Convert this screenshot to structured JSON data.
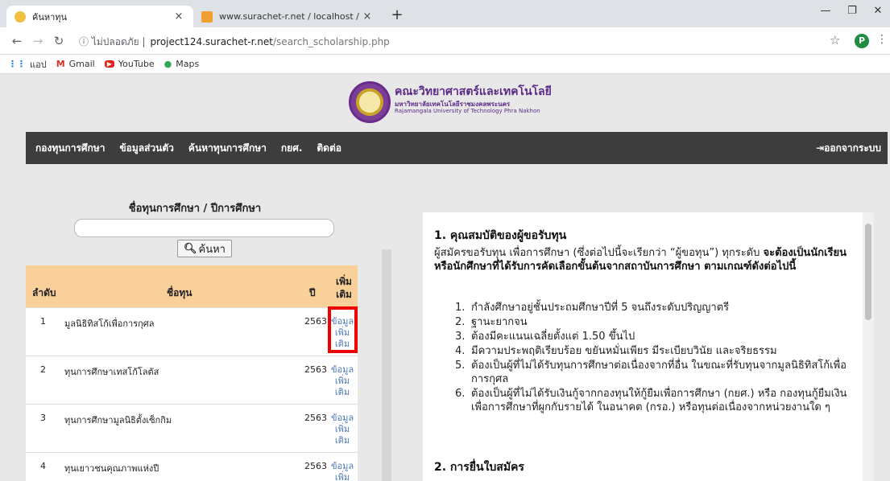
{
  "browser": {
    "tabs": [
      {
        "title": "ค้นหาทุน",
        "close": "×"
      },
      {
        "title": "www.surachet-r.net / localhost /",
        "close": "×"
      }
    ],
    "newtab": "+",
    "window": {
      "minimize": "—",
      "maximize": "❐",
      "close": "✕"
    },
    "address": {
      "security": "ⓘ ไม่ปลอดภัย |",
      "host": "project124.surachet-r.net",
      "path": "/search_scholarship.php"
    },
    "avatar_letter": "P",
    "bookmarks": [
      {
        "label": "แอป",
        "icon": "apps-grid"
      },
      {
        "label": "Gmail",
        "icon": "gmail"
      },
      {
        "label": "YouTube",
        "icon": "youtube"
      },
      {
        "label": "Maps",
        "icon": "maps-pin"
      }
    ]
  },
  "header": {
    "title": "คณะวิทยาศาสตร์และเทคโนโลยี",
    "sub1": "มหาวิทยาลัยเทคโนโลยีราชมงคลพระนคร",
    "sub2": "Rajamangala University of Technology Phra Nakhon"
  },
  "nav": {
    "items": [
      "กองทุนการศึกษา",
      "ข้อมูลส่วนตัว",
      "ค้นหาทุนการศึกษา",
      "กยศ.",
      "ติดต่อ"
    ],
    "logout": "ออกจากระบบ"
  },
  "search": {
    "label": "ชื่อทุนการศึกษา / ปีการศึกษา",
    "button": "ค้นหา"
  },
  "table": {
    "headers": {
      "no": "ลำดับ",
      "name": "ชื่อทุน",
      "year": "ปี",
      "more": "เพิ่มเติม"
    },
    "more_link": "ข้อมูลเพิ่มเติม",
    "rows": [
      {
        "no": "1",
        "name": "มูลนิธิทิสโก้เพื่อการกุศล",
        "year": "2563"
      },
      {
        "no": "2",
        "name": "ทุนการศึกษาเทสโก้โลตัส",
        "year": "2563"
      },
      {
        "no": "3",
        "name": "ทุนการศึกษามูลนิธิตั้งเซ็กกิม",
        "year": "2563"
      },
      {
        "no": "4",
        "name": "ทุนเยาวชนคุณภาพแห่งปี",
        "year": "2563"
      }
    ]
  },
  "detail": {
    "h1": "1. คุณสมบัติของผู้ขอรับทุน",
    "intro_a": "ผู้สมัครขอรับทุน เพื่อการศึกษา (ซึ่งต่อไปนี้จะเรียกว่า “ผู้ขอทุน”) ทุกระดับ ",
    "intro_b": "จะต้องเป็นนักเรียนหรือนักศึกษาที่ได้รับการคัดเลือกขั้นต้นจากสถาบันการศึกษา ตามเกณฑ์ดังต่อไปนี้",
    "items": [
      "กำลังศึกษาอยู่ชั้นประถมศึกษาปีที่ 5 จนถึงระดับปริญญาตรี",
      "ฐานะยากจน",
      "ต้องมีคะแนนเฉลี่ยตั้งแต่ 1.50 ขึ้นไป",
      "มีความประพฤติเรียบร้อย ขยันหมั่นเพียร มีระเบียบวินัย และจริยธรรม",
      "ต้องเป็นผู้ที่ไม่ได้รับทุนการศึกษาต่อเนื่องจากที่อื่น ในขณะที่รับทุนจากมูลนิธิทิสโก้เพื่อการกุศล",
      "ต้องเป็นผู้ที่ไม่ได้รับเงินกู้จากกองทุนให้กู้ยืมเพื่อการศึกษา (กยศ.) หรือ กองทุนกู้ยืมเงินเพื่อการศึกษาที่ผูกกับรายได้ ในอนาคต (กรอ.) หรือทุนต่อเนื่องจากหน่วยงานใด ๆ"
    ],
    "h2": "2. การยื่นใบสมัคร"
  }
}
